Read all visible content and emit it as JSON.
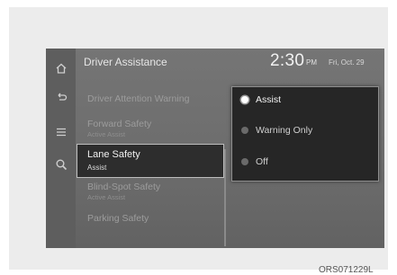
{
  "header": {
    "title": "Driver Assistance",
    "time": "2:30",
    "ampm": "PM",
    "date": "Fri, Oct. 29"
  },
  "sidebar": {
    "icons": [
      "home-icon",
      "back-icon",
      "menu-icon",
      "search-icon"
    ]
  },
  "menu": {
    "items": [
      {
        "label": "Driver Attention Warning",
        "sub": ""
      },
      {
        "label": "Forward Safety",
        "sub": "Active Assist"
      },
      {
        "label": "Lane Safety",
        "sub": "Assist"
      },
      {
        "label": "Blind-Spot Safety",
        "sub": "Active Assist"
      },
      {
        "label": "Parking Safety",
        "sub": ""
      }
    ],
    "selected_index": 2
  },
  "options": {
    "items": [
      "Assist",
      "Warning Only",
      "Off"
    ],
    "selected_index": 0
  },
  "caption": {
    "code": "ORS071229L"
  },
  "colors": {
    "screen_bg": "#6e6e6e",
    "panel_bg": "#262626",
    "selected_bg": "#2d2d2d"
  }
}
